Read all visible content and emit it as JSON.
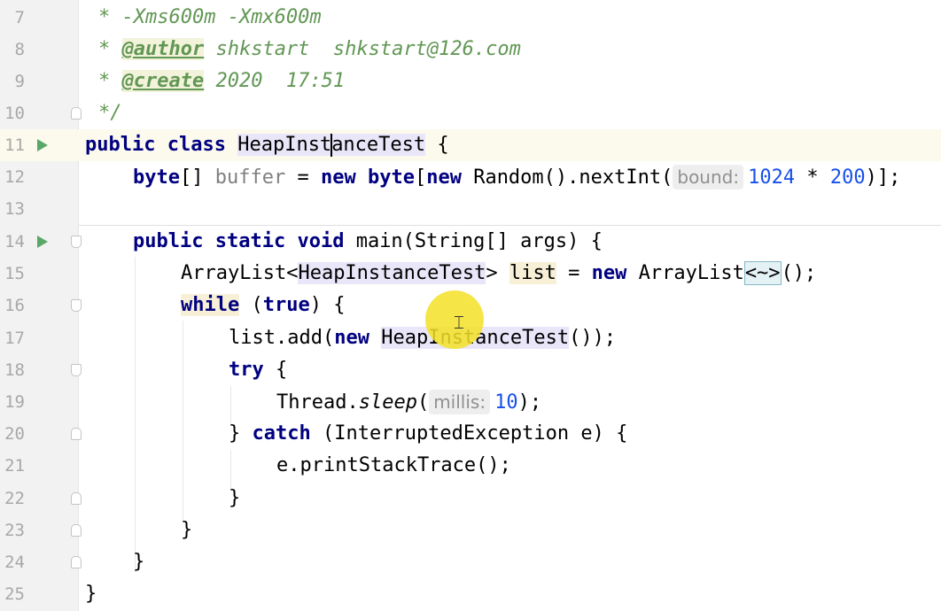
{
  "editor": {
    "line_numbers": [
      "7",
      "8",
      "9",
      "10",
      "11",
      "12",
      "13",
      "14",
      "15",
      "16",
      "17",
      "18",
      "19",
      "20",
      "21",
      "22",
      "23",
      "24",
      "25"
    ],
    "colors": {
      "comment": "#629755",
      "keyword": "#000080",
      "number": "#1750eb",
      "run_icon": "#59a869",
      "gutter_bg": "#f2f2f2",
      "current_line_bg": "#fcfaed"
    },
    "comment": {
      "l7": "* -Xms600m -Xmx600m",
      "l8_star": "*",
      "l8_tag": "@author",
      "l8_rest": " shkstart  shkstart@126.com",
      "l9_star": "*",
      "l9_tag": "@create",
      "l9_rest": " 2020  17:51",
      "l10": "*/"
    },
    "l11": {
      "kw1": "public",
      "kw2": "class",
      "name_a": "HeapInst",
      "name_b": "anceTest",
      "brace": " {"
    },
    "l12": {
      "kw_type": "byte",
      "brackets": "[] ",
      "field": "buffer",
      "eq": " = ",
      "kw_new": "new",
      "kw_type2": "byte",
      "open": "[",
      "kw_new2": "new",
      "call": " Random().nextInt(",
      "hint": "bound:",
      "n1": "1024",
      "op": " * ",
      "n2": "200",
      "close": ")];"
    },
    "l14": {
      "kw1": "public",
      "kw2": "static",
      "kw3": "void",
      "sig": " main(String[] args) {"
    },
    "l15": {
      "type": "ArrayList<",
      "generic": "HeapInstanceTest",
      "gt": "> ",
      "var": "list",
      "eq": " = ",
      "kw_new": "new",
      "ctor": " ArrayList",
      "diamond": "<~>",
      "end": "();"
    },
    "l16": {
      "kw": "while",
      "open": " (",
      "kw_true": "true",
      "close": ") {"
    },
    "l17": {
      "call": "list.add(",
      "kw_new": "new",
      "space": " ",
      "cls": "HeapInstanceTest",
      "end": "());"
    },
    "l18": {
      "kw": "try",
      "brace": " {"
    },
    "l19": {
      "cls": "Thread.",
      "method": "sleep",
      "open": "(",
      "hint": "millis:",
      "num": "10",
      "end": ");"
    },
    "l20": {
      "brace": "} ",
      "kw": "catch",
      "rest": " (InterruptedException e) {"
    },
    "l21": {
      "text": "e.printStackTrace();"
    },
    "l22": {
      "text": "}"
    },
    "l23": {
      "text": "}"
    },
    "l24": {
      "text": "}"
    },
    "l25": {
      "text": "}"
    }
  }
}
